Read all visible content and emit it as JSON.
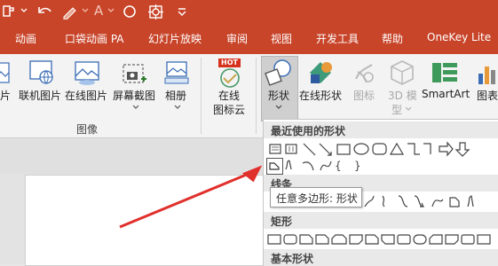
{
  "tabs": [
    "动画",
    "口袋动画 PA",
    "幻灯片放映",
    "审阅",
    "视图",
    "开发工具",
    "帮助",
    "OneKey Lite"
  ],
  "ribbon": {
    "images_group": {
      "label": "图像",
      "buttons": [
        "片",
        "联机图片",
        "在线图片",
        "屏幕截图",
        "相册"
      ]
    },
    "online_icon": {
      "line1": "在线",
      "line2": "图标云",
      "badge": "HOT"
    },
    "illustration_buttons": {
      "shapes": "形状",
      "online_shapes": "在线形状",
      "icons": "图标",
      "model_line1": "3D 模",
      "model_line2": "型",
      "smartart": "SmartArt",
      "chart": "图表"
    }
  },
  "dropdown": {
    "recent": "最近使用的形状",
    "lines": "线条",
    "rectangles": "矩形",
    "basic": "基本形状"
  },
  "tooltip": "任意多边形: 形状",
  "colors": {
    "accent": "#c8452a",
    "arrow": "#e0302c",
    "icon_blue": "#3a6cb5"
  },
  "icons": [
    "format-painter-icon",
    "undo-icon",
    "pen-icon",
    "font-color-icon",
    "circle-icon",
    "target-icon",
    "qat-more-icon",
    "hot-badge-icon",
    "freeform-shape-icon",
    "red-pointer-arrow-icon"
  ]
}
